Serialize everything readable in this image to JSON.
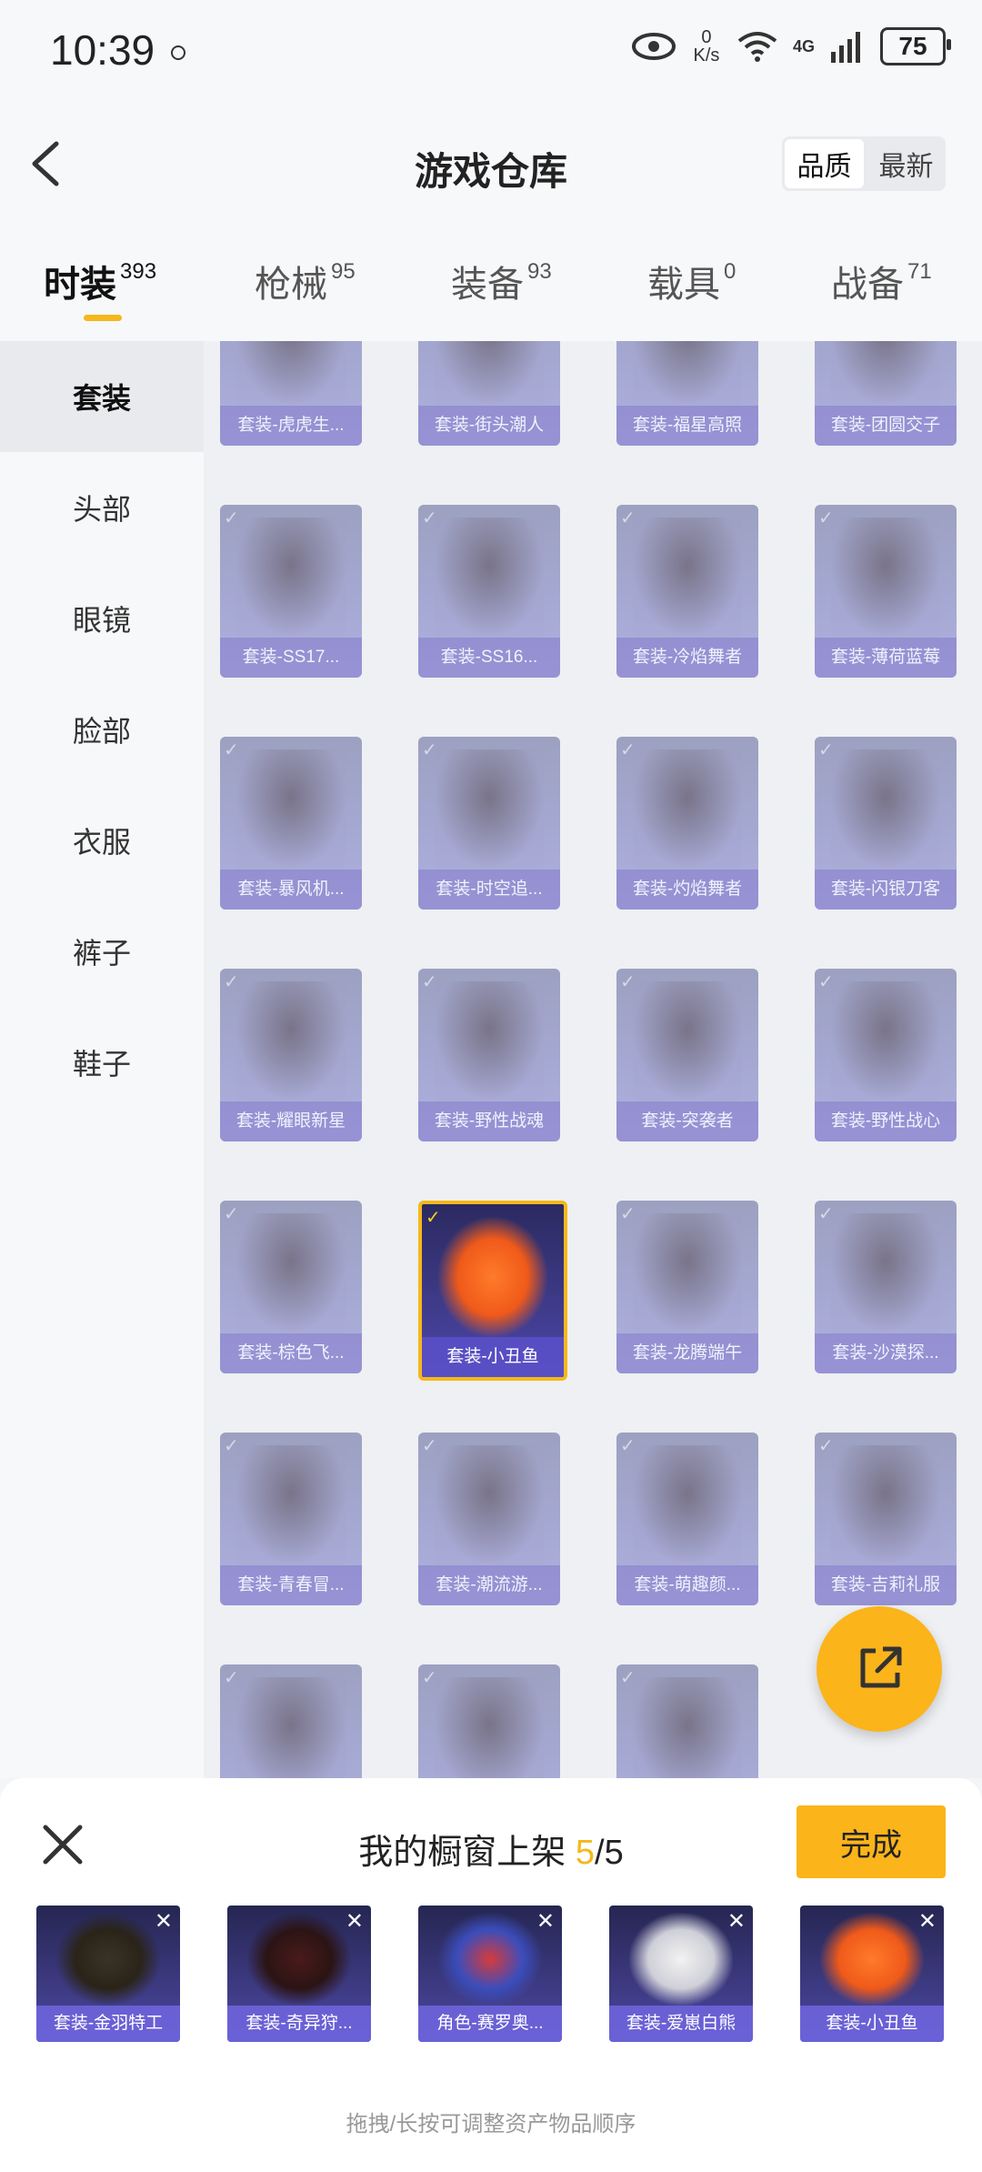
{
  "status": {
    "time": "10:39",
    "speed_top": "0",
    "speed_unit": "K/s",
    "network": "4G",
    "battery": "75"
  },
  "header": {
    "title": "游戏仓库",
    "sort": [
      "品质",
      "最新"
    ]
  },
  "tabs": [
    {
      "label": "时装",
      "count": "393"
    },
    {
      "label": "枪械",
      "count": "95"
    },
    {
      "label": "装备",
      "count": "93"
    },
    {
      "label": "载具",
      "count": "0"
    },
    {
      "label": "战备",
      "count": "71"
    }
  ],
  "sidebar": [
    "套装",
    "头部",
    "眼镜",
    "脸部",
    "衣服",
    "裤子",
    "鞋子"
  ],
  "items": [
    "套装-虎虎生...",
    "套装-街头潮人",
    "套装-福星高照",
    "套装-团圆交子",
    "套装-SS17...",
    "套装-SS16...",
    "套装-冷焰舞者",
    "套装-薄荷蓝莓",
    "套装-暴风机...",
    "套装-时空追...",
    "套装-灼焰舞者",
    "套装-闪银刀客",
    "套装-耀眼新星",
    "套装-野性战魂",
    "套装-突袭者",
    "套装-野性战心",
    "套装-棕色飞...",
    "套装-小丑鱼",
    "套装-龙腾端午",
    "套装-沙漠探...",
    "套装-青春冒...",
    "套装-潮流游...",
    "套装-萌趣颜...",
    "套装-吉莉礼服",
    "",
    "",
    ""
  ],
  "selected_item": "套装-小丑鱼",
  "shelf": {
    "title_prefix": "我的橱窗上架 ",
    "used": "5",
    "sep": "/",
    "total": "5",
    "done": "完成",
    "items": [
      "套装-金羽特工",
      "套装-奇异狩...",
      "角色-赛罗奥...",
      "套装-爱崽白熊",
      "套装-小丑鱼"
    ],
    "hint": "拖拽/长按可调整资产物品顺序"
  },
  "colors": {
    "accent": "#fbb41a",
    "card": "#9a9dcf",
    "selected_border": "#f5b81c"
  }
}
